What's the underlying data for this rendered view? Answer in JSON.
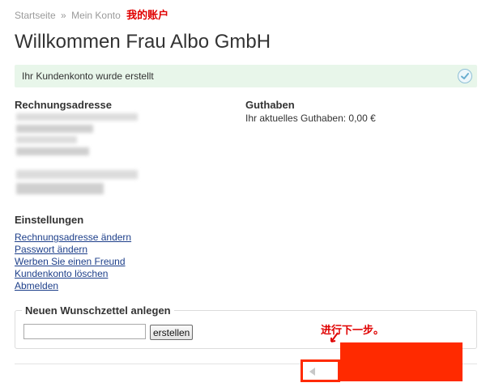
{
  "breadcrumb": {
    "items": [
      "Startseite",
      "Mein Konto"
    ],
    "separator": "»",
    "annotation": "我的账户"
  },
  "page_title": "Willkommen Frau Albo GmbH",
  "success": {
    "message": "Ihr Kundenkonto wurde erstellt",
    "icon": "check-circle-icon"
  },
  "billing": {
    "title": "Rechnungsadresse"
  },
  "credit": {
    "title": "Guthaben",
    "text": "Ihr aktuelles Guthaben: 0,00 €"
  },
  "settings": {
    "title": "Einstellungen",
    "links": [
      "Rechnungsadresse ändern",
      "Passwort ändern",
      "Werben Sie einen Freund",
      "Kundenkonto löschen",
      "Abmelden"
    ]
  },
  "wishlist": {
    "legend": "Neuen Wunschzettel anlegen",
    "input_value": "",
    "button_label": "erstellen"
  },
  "annotation": {
    "text": "进行下一步。",
    "color": "#e00000",
    "highlight_color": "#ff2a00"
  },
  "colors": {
    "link": "#1d3f8a",
    "success_bg": "#e8f6ea"
  }
}
